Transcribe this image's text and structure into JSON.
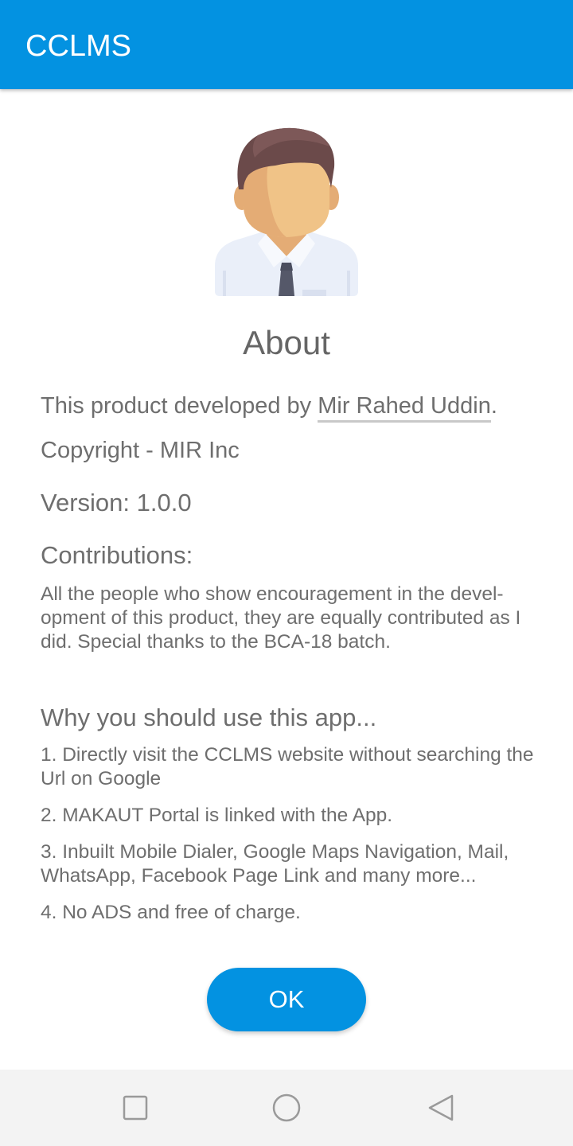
{
  "appbar": {
    "title": "CCLMS",
    "color": "#0392e1"
  },
  "about": {
    "title": "About",
    "developed_prefix": "This product developed by ",
    "developer_name": "Mir Rahed Uddin",
    "developed_suffix": ".",
    "copyright": "Copyright - MIR Inc",
    "version": "Version: 1.0.0",
    "contributions_heading": "Contributions:",
    "contributions_body": "All the people who show encouragement in the devel-opment of this product, they are equally contributed as I did. Special thanks to the BCA-18 batch.",
    "why_heading": "Why you should use this app...",
    "why_items": [
      "1. Directly visit the CCLMS website without searching the Url on Google",
      "2. MAKAUT Portal is linked with the App.",
      "3. Inbuilt Mobile Dialer, Google Maps Navigation, Mail, WhatsApp, Facebook Page Link and many more...",
      "4. No ADS and free of charge."
    ]
  },
  "ok_button": {
    "label": "OK"
  },
  "navbar": {
    "icons": [
      "recent-apps-icon",
      "home-icon",
      "back-icon"
    ]
  }
}
